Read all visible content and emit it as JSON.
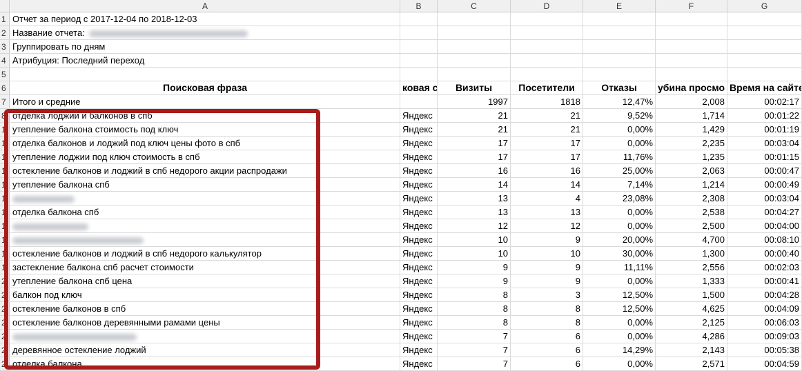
{
  "columns": [
    "A",
    "B",
    "C",
    "D",
    "E",
    "F",
    "G"
  ],
  "rows_meta": [
    {
      "num": "1",
      "a": "Отчет за период с 2017-12-04 по 2018-12-03"
    },
    {
      "num": "2",
      "a": "Название отчета:"
    },
    {
      "num": "3",
      "a": "Группировать по дням"
    },
    {
      "num": "4",
      "a": "Атрибуция: Последний переход"
    },
    {
      "num": "5",
      "a": ""
    }
  ],
  "header_row": {
    "num": "6",
    "a": "Поисковая фраза",
    "b": "ковая си",
    "c": "Визиты",
    "d": "Посетители",
    "e": "Отказы",
    "f": "убина просмо",
    "g": "Время на сайте"
  },
  "total_row": {
    "num": "7",
    "a": "Итого и средние",
    "c": "1997",
    "d": "1818",
    "e": "12,47%",
    "f": "2,008",
    "g": "00:02:17"
  },
  "data_rows": [
    {
      "num": "8",
      "a": "отделка лоджии и балконов в спб",
      "b": "Яндекс",
      "c": "21",
      "d": "21",
      "e": "9,52%",
      "f": "1,714",
      "g": "00:01:22"
    },
    {
      "num": "1",
      "a": "утепление балкона стоимость под ключ",
      "b": "Яндекс",
      "c": "21",
      "d": "21",
      "e": "0,00%",
      "f": "1,429",
      "g": "00:01:19"
    },
    {
      "num": "1",
      "a": "отделка балконов и лоджий под ключ цены фото в спб",
      "b": "Яндекс",
      "c": "17",
      "d": "17",
      "e": "0,00%",
      "f": "2,235",
      "g": "00:03:04"
    },
    {
      "num": "1",
      "a": "утепление лоджии под ключ стоимость в спб",
      "b": "Яндекс",
      "c": "17",
      "d": "17",
      "e": "11,76%",
      "f": "1,235",
      "g": "00:01:15"
    },
    {
      "num": "1",
      "a": "остекление балконов и лоджий в спб недорого акции распродажи",
      "b": "Яндекс",
      "c": "16",
      "d": "16",
      "e": "25,00%",
      "f": "2,063",
      "g": "00:00:47"
    },
    {
      "num": "1",
      "a": "утепление балкона спб",
      "b": "Яндекс",
      "c": "14",
      "d": "14",
      "e": "7,14%",
      "f": "1,214",
      "g": "00:00:49"
    },
    {
      "num": "1",
      "a": "",
      "b": "Яндекс",
      "c": "13",
      "d": "4",
      "e": "23,08%",
      "f": "2,308",
      "g": "00:03:04",
      "blur": 90
    },
    {
      "num": "1",
      "a": "отделка балкона спб",
      "b": "Яндекс",
      "c": "13",
      "d": "13",
      "e": "0,00%",
      "f": "2,538",
      "g": "00:04:27"
    },
    {
      "num": "1",
      "a": "",
      "b": "Яндекс",
      "c": "12",
      "d": "12",
      "e": "0,00%",
      "f": "2,500",
      "g": "00:04:00",
      "blur": 110
    },
    {
      "num": "1",
      "a": "",
      "b": "Яндекс",
      "c": "10",
      "d": "9",
      "e": "20,00%",
      "f": "4,700",
      "g": "00:08:10",
      "blur": 190
    },
    {
      "num": "1",
      "a": "остекление балконов и лоджий в спб недорого калькулятор",
      "b": "Яндекс",
      "c": "10",
      "d": "10",
      "e": "30,00%",
      "f": "1,300",
      "g": "00:00:40"
    },
    {
      "num": "1",
      "a": "застекление балкона спб расчет стоимости",
      "b": "Яндекс",
      "c": "9",
      "d": "9",
      "e": "11,11%",
      "f": "2,556",
      "g": "00:02:03"
    },
    {
      "num": "2",
      "a": "утепление балкона спб цена",
      "b": "Яндекс",
      "c": "9",
      "d": "9",
      "e": "0,00%",
      "f": "1,333",
      "g": "00:00:41"
    },
    {
      "num": "2",
      "a": "балкон под ключ",
      "b": "Яндекс",
      "c": "8",
      "d": "3",
      "e": "12,50%",
      "f": "1,500",
      "g": "00:04:28"
    },
    {
      "num": "2",
      "a": "остекление балконов в спб",
      "b": "Яндекс",
      "c": "8",
      "d": "8",
      "e": "12,50%",
      "f": "4,625",
      "g": "00:04:09"
    },
    {
      "num": "2",
      "a": "остекление балконов деревянными рамами цены",
      "b": "Яндекс",
      "c": "8",
      "d": "8",
      "e": "0,00%",
      "f": "2,125",
      "g": "00:06:03"
    },
    {
      "num": "2",
      "a": "",
      "b": "Яндекс",
      "c": "7",
      "d": "6",
      "e": "0,00%",
      "f": "4,286",
      "g": "00:09:03",
      "blur": 180
    },
    {
      "num": "2",
      "a": "деревянное остекление лоджий",
      "b": "Яндекс",
      "c": "7",
      "d": "6",
      "e": "14,29%",
      "f": "2,143",
      "g": "00:05:38"
    },
    {
      "num": "2",
      "a": "отделка балкона",
      "b": "Яндекс",
      "c": "7",
      "d": "6",
      "e": "0,00%",
      "f": "2,571",
      "g": "00:04:59"
    }
  ],
  "highlight_color": "#a81c1c"
}
